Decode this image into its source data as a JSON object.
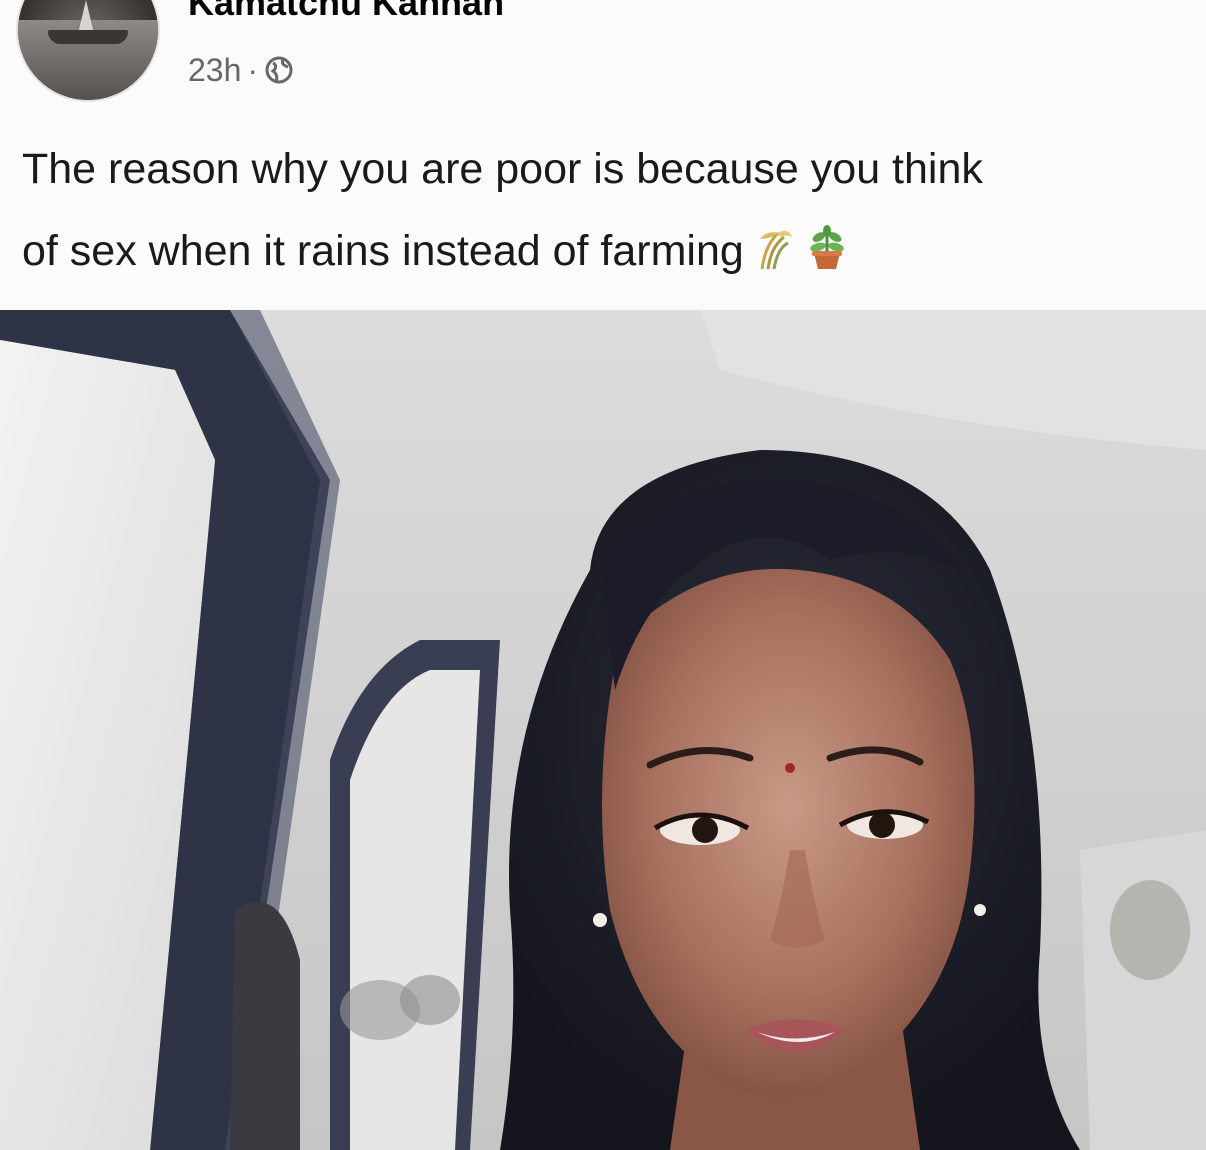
{
  "post": {
    "author_name": "Kamatchu Kannan",
    "time": "23h",
    "separator": "·",
    "privacy_icon": "globe-icon",
    "text_line_1": "The reason why you are poor is because you think",
    "text_line_2": "of sex when it rains instead of farming",
    "emojis": [
      "sheaf-of-rice-icon",
      "potted-plant-icon"
    ]
  },
  "colors": {
    "meta_gray": "#65676b",
    "text": "#1a1a1a",
    "background": "#fbfbfb"
  }
}
